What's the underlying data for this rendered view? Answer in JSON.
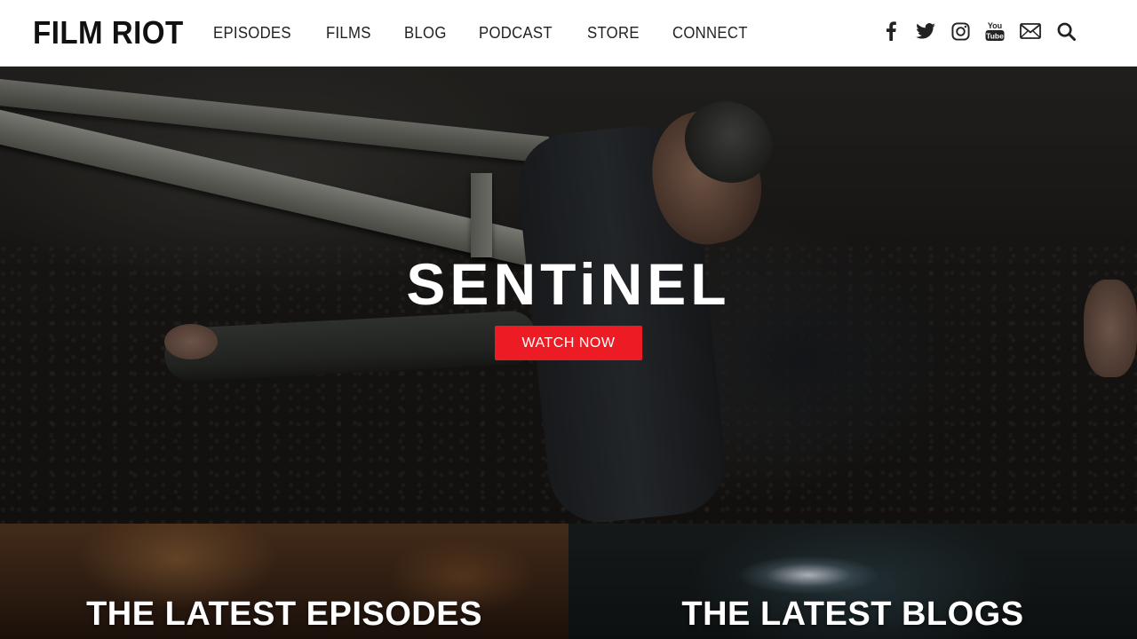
{
  "header": {
    "logo": "FILM RIOT",
    "nav": [
      "EPISODES",
      "FILMS",
      "BLOG",
      "PODCAST",
      "STORE",
      "CONNECT"
    ],
    "social_icons": [
      "facebook-icon",
      "twitter-icon",
      "instagram-icon",
      "youtube-icon",
      "email-icon",
      "search-icon"
    ],
    "youtube_icon_text": [
      "You",
      "Tube"
    ]
  },
  "hero": {
    "title": "SENTiNEL",
    "button_label": "WATCH NOW",
    "button_color": "#ed1c24"
  },
  "tiles": [
    {
      "title": "THE LATEST EPISODES"
    },
    {
      "title": "THE LATEST BLOGS"
    }
  ],
  "colors": {
    "header_bg": "#ffffff",
    "text_dark": "#111111",
    "accent": "#ed1c24"
  }
}
